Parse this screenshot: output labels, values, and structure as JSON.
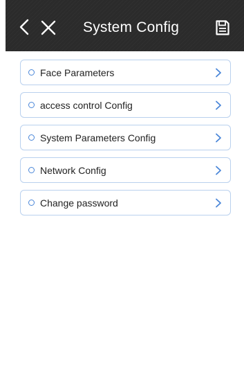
{
  "header": {
    "title": "System Config",
    "background": "#2b2b2b",
    "icons": {
      "back": "chevron-left-icon",
      "close": "close-icon",
      "save": "save-icon"
    }
  },
  "menu": {
    "accent_color": "#4a86d8",
    "border_color": "#b9d0ee",
    "items": [
      {
        "label": "Face Parameters",
        "icon": "chevron-right-icon"
      },
      {
        "label": "access control Config",
        "icon": "chevron-right-icon"
      },
      {
        "label": "System Parameters Config",
        "icon": "chevron-right-icon"
      },
      {
        "label": "Network Config",
        "icon": "chevron-right-icon"
      },
      {
        "label": "Change password",
        "icon": "chevron-right-icon"
      }
    ]
  }
}
